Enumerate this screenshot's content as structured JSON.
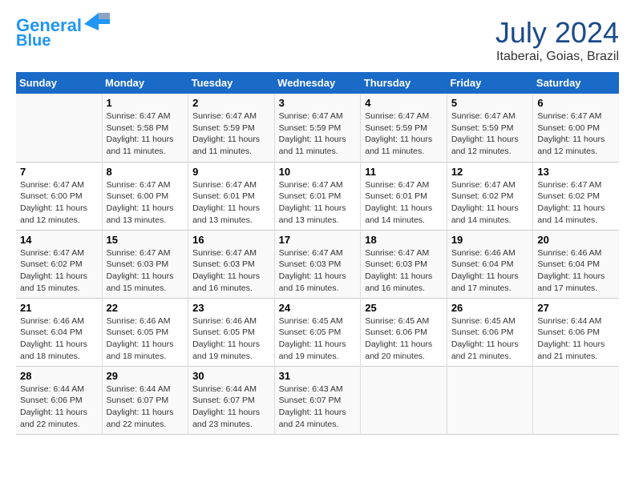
{
  "header": {
    "logo_line1": "General",
    "logo_line2": "Blue",
    "month_year": "July 2024",
    "location": "Itaberai, Goias, Brazil"
  },
  "days_of_week": [
    "Sunday",
    "Monday",
    "Tuesday",
    "Wednesday",
    "Thursday",
    "Friday",
    "Saturday"
  ],
  "weeks": [
    [
      {
        "day": "",
        "info": ""
      },
      {
        "day": "1",
        "info": "Sunrise: 6:47 AM\nSunset: 5:58 PM\nDaylight: 11 hours\nand 11 minutes."
      },
      {
        "day": "2",
        "info": "Sunrise: 6:47 AM\nSunset: 5:59 PM\nDaylight: 11 hours\nand 11 minutes."
      },
      {
        "day": "3",
        "info": "Sunrise: 6:47 AM\nSunset: 5:59 PM\nDaylight: 11 hours\nand 11 minutes."
      },
      {
        "day": "4",
        "info": "Sunrise: 6:47 AM\nSunset: 5:59 PM\nDaylight: 11 hours\nand 11 minutes."
      },
      {
        "day": "5",
        "info": "Sunrise: 6:47 AM\nSunset: 5:59 PM\nDaylight: 11 hours\nand 12 minutes."
      },
      {
        "day": "6",
        "info": "Sunrise: 6:47 AM\nSunset: 6:00 PM\nDaylight: 11 hours\nand 12 minutes."
      }
    ],
    [
      {
        "day": "7",
        "info": "Sunrise: 6:47 AM\nSunset: 6:00 PM\nDaylight: 11 hours\nand 12 minutes."
      },
      {
        "day": "8",
        "info": "Sunrise: 6:47 AM\nSunset: 6:00 PM\nDaylight: 11 hours\nand 13 minutes."
      },
      {
        "day": "9",
        "info": "Sunrise: 6:47 AM\nSunset: 6:01 PM\nDaylight: 11 hours\nand 13 minutes."
      },
      {
        "day": "10",
        "info": "Sunrise: 6:47 AM\nSunset: 6:01 PM\nDaylight: 11 hours\nand 13 minutes."
      },
      {
        "day": "11",
        "info": "Sunrise: 6:47 AM\nSunset: 6:01 PM\nDaylight: 11 hours\nand 14 minutes."
      },
      {
        "day": "12",
        "info": "Sunrise: 6:47 AM\nSunset: 6:02 PM\nDaylight: 11 hours\nand 14 minutes."
      },
      {
        "day": "13",
        "info": "Sunrise: 6:47 AM\nSunset: 6:02 PM\nDaylight: 11 hours\nand 14 minutes."
      }
    ],
    [
      {
        "day": "14",
        "info": "Sunrise: 6:47 AM\nSunset: 6:02 PM\nDaylight: 11 hours\nand 15 minutes."
      },
      {
        "day": "15",
        "info": "Sunrise: 6:47 AM\nSunset: 6:03 PM\nDaylight: 11 hours\nand 15 minutes."
      },
      {
        "day": "16",
        "info": "Sunrise: 6:47 AM\nSunset: 6:03 PM\nDaylight: 11 hours\nand 16 minutes."
      },
      {
        "day": "17",
        "info": "Sunrise: 6:47 AM\nSunset: 6:03 PM\nDaylight: 11 hours\nand 16 minutes."
      },
      {
        "day": "18",
        "info": "Sunrise: 6:47 AM\nSunset: 6:03 PM\nDaylight: 11 hours\nand 16 minutes."
      },
      {
        "day": "19",
        "info": "Sunrise: 6:46 AM\nSunset: 6:04 PM\nDaylight: 11 hours\nand 17 minutes."
      },
      {
        "day": "20",
        "info": "Sunrise: 6:46 AM\nSunset: 6:04 PM\nDaylight: 11 hours\nand 17 minutes."
      }
    ],
    [
      {
        "day": "21",
        "info": "Sunrise: 6:46 AM\nSunset: 6:04 PM\nDaylight: 11 hours\nand 18 minutes."
      },
      {
        "day": "22",
        "info": "Sunrise: 6:46 AM\nSunset: 6:05 PM\nDaylight: 11 hours\nand 18 minutes."
      },
      {
        "day": "23",
        "info": "Sunrise: 6:46 AM\nSunset: 6:05 PM\nDaylight: 11 hours\nand 19 minutes."
      },
      {
        "day": "24",
        "info": "Sunrise: 6:45 AM\nSunset: 6:05 PM\nDaylight: 11 hours\nand 19 minutes."
      },
      {
        "day": "25",
        "info": "Sunrise: 6:45 AM\nSunset: 6:06 PM\nDaylight: 11 hours\nand 20 minutes."
      },
      {
        "day": "26",
        "info": "Sunrise: 6:45 AM\nSunset: 6:06 PM\nDaylight: 11 hours\nand 21 minutes."
      },
      {
        "day": "27",
        "info": "Sunrise: 6:44 AM\nSunset: 6:06 PM\nDaylight: 11 hours\nand 21 minutes."
      }
    ],
    [
      {
        "day": "28",
        "info": "Sunrise: 6:44 AM\nSunset: 6:06 PM\nDaylight: 11 hours\nand 22 minutes."
      },
      {
        "day": "29",
        "info": "Sunrise: 6:44 AM\nSunset: 6:07 PM\nDaylight: 11 hours\nand 22 minutes."
      },
      {
        "day": "30",
        "info": "Sunrise: 6:44 AM\nSunset: 6:07 PM\nDaylight: 11 hours\nand 23 minutes."
      },
      {
        "day": "31",
        "info": "Sunrise: 6:43 AM\nSunset: 6:07 PM\nDaylight: 11 hours\nand 24 minutes."
      },
      {
        "day": "",
        "info": ""
      },
      {
        "day": "",
        "info": ""
      },
      {
        "day": "",
        "info": ""
      }
    ]
  ]
}
